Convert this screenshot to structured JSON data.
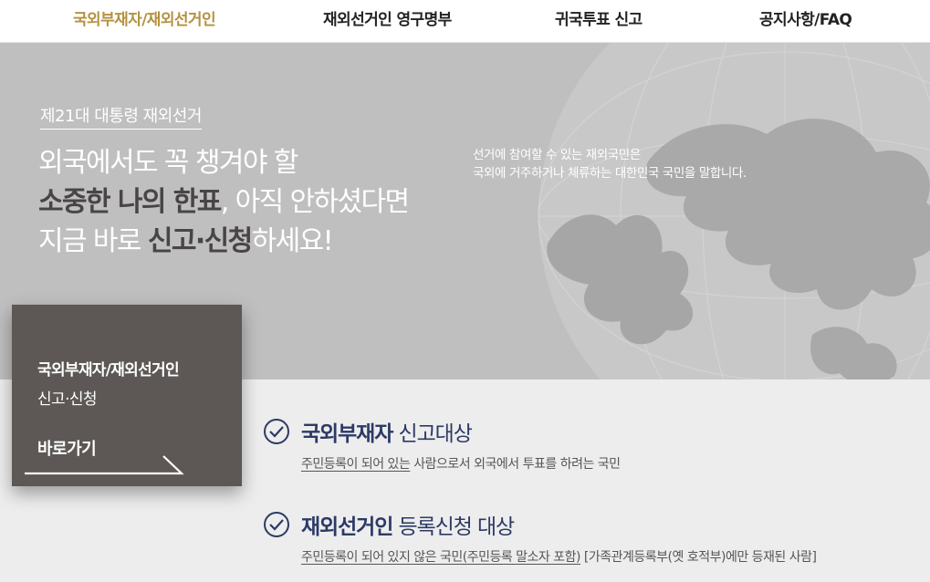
{
  "nav": {
    "items": [
      {
        "label": "국외부재자/재외선거인",
        "active": true
      },
      {
        "label": "재외선거인 영구명부",
        "active": false
      },
      {
        "label": "귀국투표 신고",
        "active": false
      },
      {
        "label": "공지사항/FAQ",
        "active": false
      }
    ]
  },
  "hero": {
    "edition": "제21대 대통령 재외선거",
    "line1": "외국에서도 꼭 챙겨야 할",
    "line2_bold_a": "소중한 나의 한표",
    "line2_rest": ", 아직 안하셨다면",
    "line3_pre": "지금 바로 ",
    "line3_bold": "신고·신청",
    "line3_post": "하세요!",
    "definition_1": "선거에 참여할 수 있는 재외국민은",
    "definition_2": "국외에 거주하거나 체류하는 대한민국 국민을 말합니다."
  },
  "cta": {
    "title": "국외부재자/재외선거인",
    "subtitle": "신고·신청",
    "go_label": "바로가기"
  },
  "targets": [
    {
      "title_bold": "국외부재자",
      "title_rest": " 신고대상",
      "desc_underlined": "주민등록이 되어 있는",
      "desc_rest": " 사람으로서 외국에서 투표를 하려는 국민"
    },
    {
      "title_bold": "재외선거인",
      "title_rest": " 등록신청 대상",
      "desc_underlined": "주민등록이 되어 있지 않은 국민(주민등록 말소자 포함)",
      "desc_rest": " [가족관계등록부(옛 호적부)에만 등재된 사람]"
    }
  ],
  "colors": {
    "nav_active": "#b4923f",
    "hero_bg": "#bfbfbf",
    "card_bg": "#5d5756",
    "target_title": "#2c3a66"
  }
}
